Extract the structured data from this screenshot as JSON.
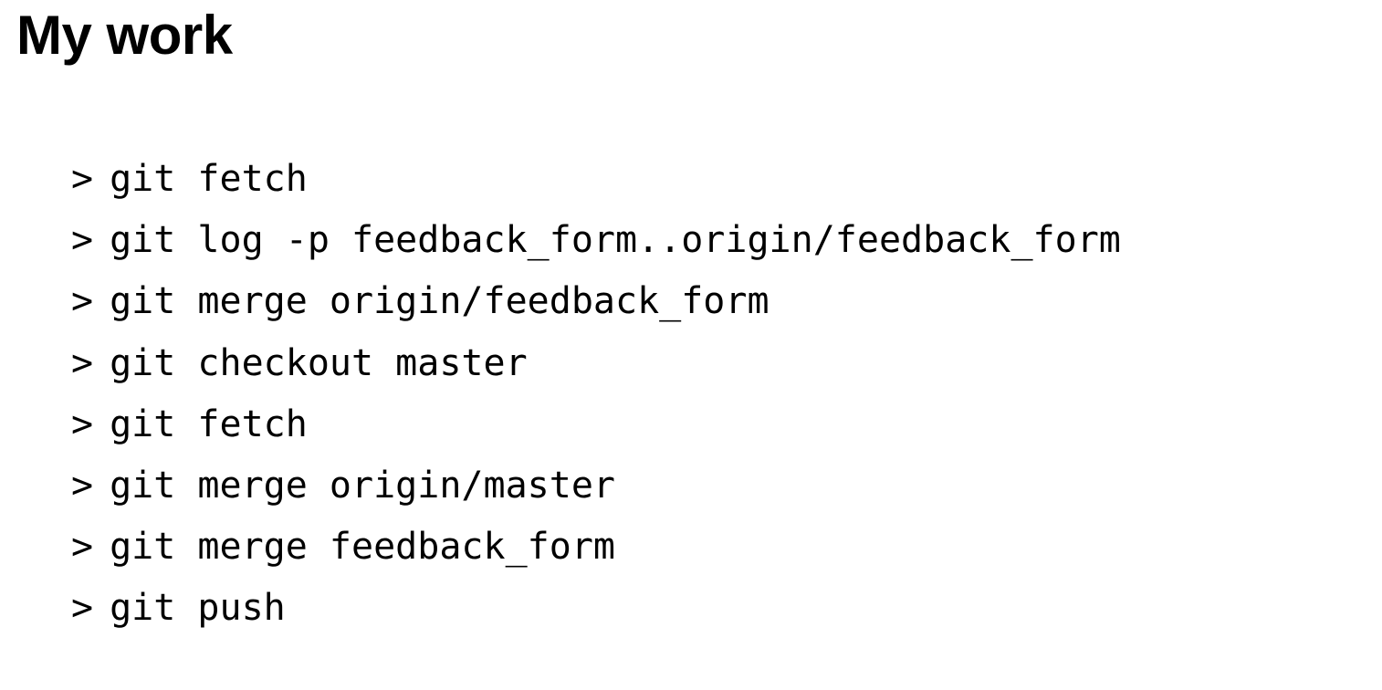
{
  "heading": "My work",
  "prompt": ">",
  "commands": [
    "git fetch",
    "git log -p feedback_form..origin/feedback_form",
    "git merge origin/feedback_form",
    "git checkout master",
    "git fetch",
    "git merge origin/master",
    "git merge feedback_form",
    "git push"
  ]
}
